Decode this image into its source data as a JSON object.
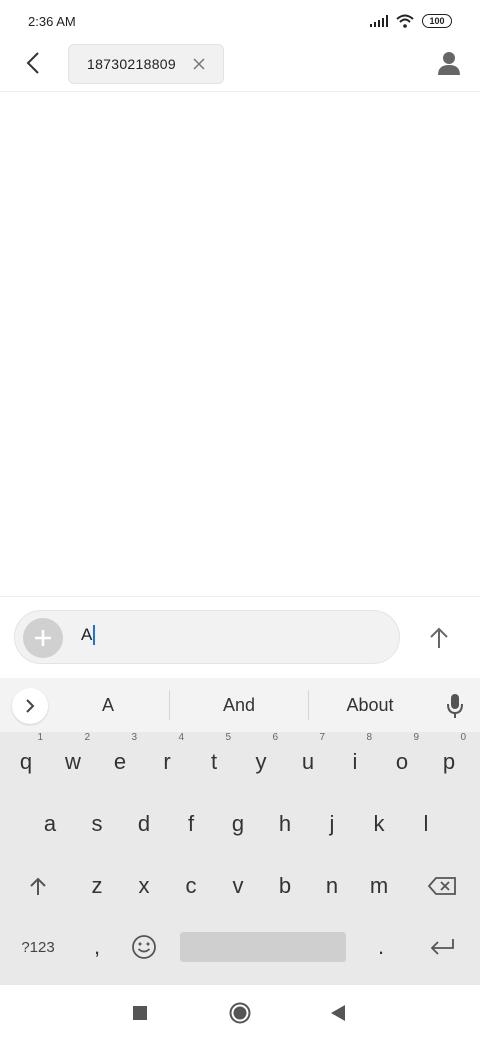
{
  "status_bar": {
    "time": "2:36 AM",
    "battery": "100"
  },
  "header": {
    "recipient": "18730218809"
  },
  "compose": {
    "text": "A"
  },
  "keyboard": {
    "suggestions": [
      "A",
      "And",
      "About"
    ],
    "row1": [
      {
        "key": "q",
        "hint": "1"
      },
      {
        "key": "w",
        "hint": "2"
      },
      {
        "key": "e",
        "hint": "3"
      },
      {
        "key": "r",
        "hint": "4"
      },
      {
        "key": "t",
        "hint": "5"
      },
      {
        "key": "y",
        "hint": "6"
      },
      {
        "key": "u",
        "hint": "7"
      },
      {
        "key": "i",
        "hint": "8"
      },
      {
        "key": "o",
        "hint": "9"
      },
      {
        "key": "p",
        "hint": "0"
      }
    ],
    "row2": [
      "a",
      "s",
      "d",
      "f",
      "g",
      "h",
      "j",
      "k",
      "l"
    ],
    "row3": [
      "z",
      "x",
      "c",
      "v",
      "b",
      "n",
      "m"
    ],
    "symbols_label": "?123",
    "comma": ",",
    "period": "."
  },
  "icons": {
    "back": "chevron-left-icon",
    "chip_close": "close-icon",
    "contact": "person-icon",
    "add": "plus-icon",
    "send": "arrow-up-icon",
    "expand": "chevron-right-icon",
    "mic": "microphone-icon",
    "shift": "shift-icon",
    "backspace": "backspace-icon",
    "emoji": "emoji-icon",
    "enter": "enter-icon",
    "recents": "square-icon",
    "home": "circle-icon",
    "nav_back": "triangle-left-icon"
  },
  "colors": {
    "caret": "#1a73e8",
    "keyboard_bg": "#e9e9e9"
  }
}
